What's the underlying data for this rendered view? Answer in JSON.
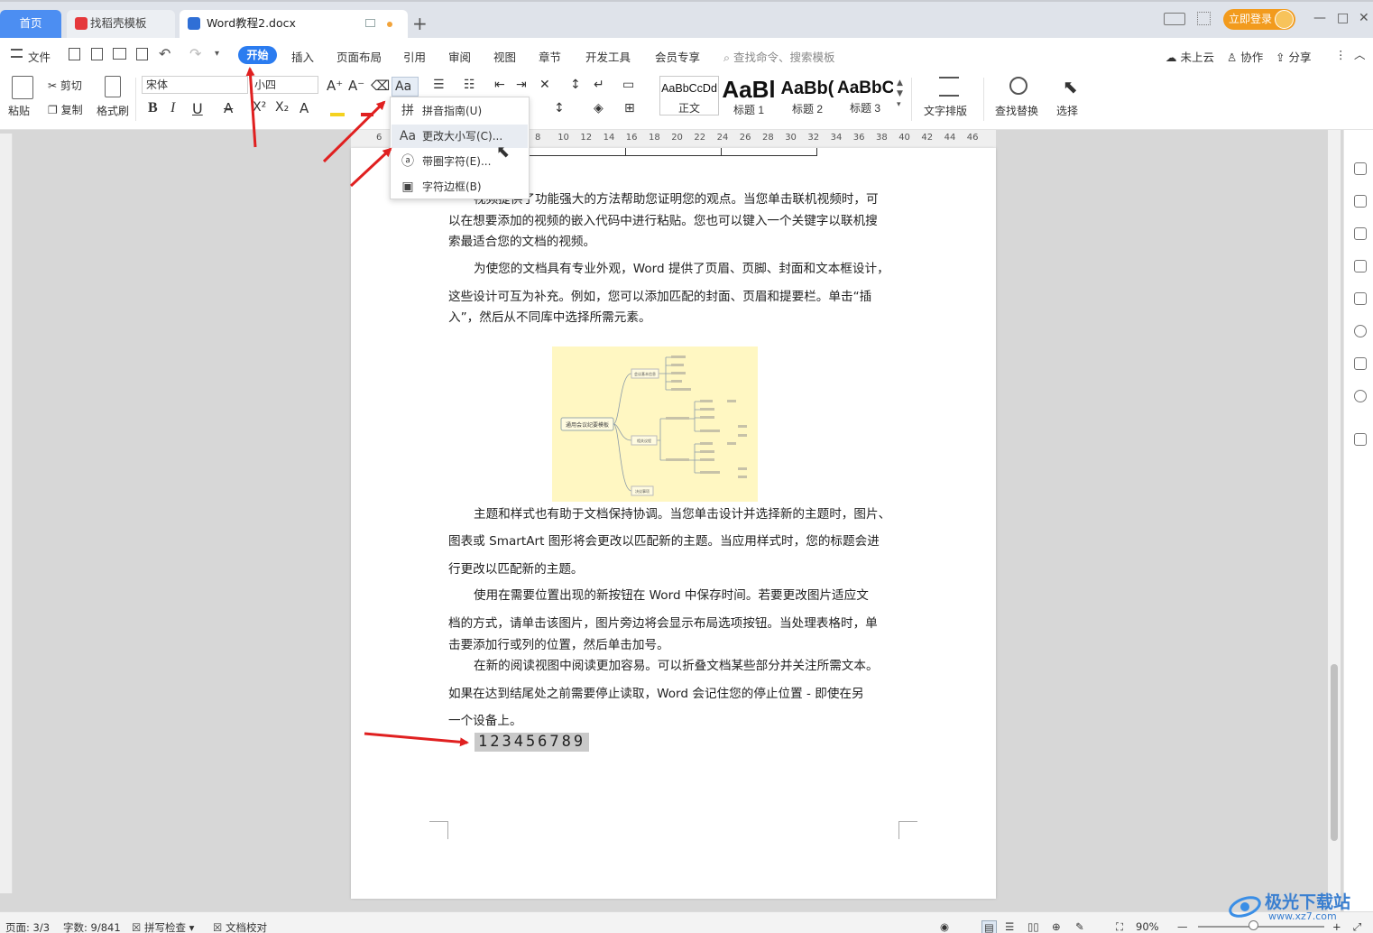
{
  "titlebar": {
    "tabs": [
      {
        "label": "首页"
      },
      {
        "label": "找稻壳模板"
      },
      {
        "label": "Word教程2.docx"
      }
    ],
    "new_tab": "+",
    "login_label": "立即登录",
    "window_controls": [
      "—",
      "□",
      "✕"
    ]
  },
  "menubar": {
    "file_label": "文件",
    "items": [
      "开始",
      "插入",
      "页面布局",
      "引用",
      "审阅",
      "视图",
      "章节",
      "开发工具",
      "会员专享"
    ],
    "search_placeholder": "查找命令、搜索模板",
    "right_items": [
      "未上云",
      "协作",
      "分享"
    ]
  },
  "ribbon": {
    "paste": "粘贴",
    "cut": "剪切",
    "copy": "复制",
    "format_painter": "格式刷",
    "font_name": "宋体",
    "font_size": "小四",
    "change_case_label": "Aa",
    "styles": [
      {
        "preview": "AaBbCcDd",
        "label": "正文"
      },
      {
        "preview": "AaBl",
        "label": "标题 1"
      },
      {
        "preview": "AaBb(",
        "label": "标题 2"
      },
      {
        "preview": "AaBbC",
        "label": "标题 3"
      }
    ],
    "text_layout": "文字排版",
    "find_replace": "查找替换",
    "select": "选择"
  },
  "ruler_numbers": [
    "6",
    "8",
    "10",
    "12",
    "14",
    "16",
    "18",
    "20",
    "22",
    "24",
    "26",
    "28",
    "30",
    "32",
    "34",
    "36",
    "38",
    "40",
    "42",
    "44",
    "46"
  ],
  "dropdown": {
    "items": [
      {
        "icon": "pinyin-icon",
        "label": "拼音指南(U)"
      },
      {
        "icon": "aa-icon",
        "label": "更改大小写(C)..."
      },
      {
        "icon": "circle-a-icon",
        "label": "带圈字符(E)..."
      },
      {
        "icon": "box-a-icon",
        "label": "字符边框(B)"
      }
    ]
  },
  "document": {
    "paragraphs": [
      [
        "视频提供了功能强大的方法帮助您证明您的观点。当您单击联机视频时，可",
        "以在想要添加的视频的嵌入代码中进行粘贴。您也可以键入一个关键字以联机搜",
        "索最适合您的文档的视频。"
      ],
      [
        "为使您的文档具有专业外观，Word 提供了页眉、页脚、封面和文本框设计，",
        "这些设计可互为补充。例如，您可以添加匹配的封面、页眉和提要栏。单击“插",
        "入”，然后从不同库中选择所需元素。"
      ],
      [
        "主题和样式也有助于文档保持协调。当您单击设计并选择新的主题时，图片、",
        "图表或 SmartArt 图形将会更改以匹配新的主题。当应用样式时，您的标题会进",
        "行更改以匹配新的主题。"
      ],
      [
        "使用在需要位置出现的新按钮在 Word 中保存时间。若要更改图片适应文",
        "档的方式，请单击该图片，图片旁边将会显示布局选项按钮。当处理表格时，单",
        "击要添加行或列的位置，然后单击加号。"
      ],
      [
        "在新的阅读视图中阅读更加容易。可以折叠文档某些部分并关注所需文本。",
        "如果在达到结尾处之前需要停止读取，Word 会记住您的停止位置 - 即使在另",
        "一个设备上。"
      ]
    ],
    "selected_text": "123456789",
    "mindmap": {
      "center": "通用会议纪要模板",
      "branches": [
        "会议基本信息",
        "相关议程",
        "决议事项"
      ]
    }
  },
  "statusbar": {
    "page": "页面: 3/3",
    "words": "字数: 9/841",
    "spell_check": "拼写检查",
    "doc_check": "文档校对",
    "zoom": "90%"
  },
  "watermark": {
    "text": "极光下载站",
    "url": "www.xz7.com"
  },
  "colors": {
    "accent": "#2b7cf0",
    "tab_home": "#4c8ef2",
    "login": "#f29b1d",
    "arrow": "#e02020",
    "mindmap_bg": "#fff7c2",
    "selection": "#c9c9c9"
  }
}
